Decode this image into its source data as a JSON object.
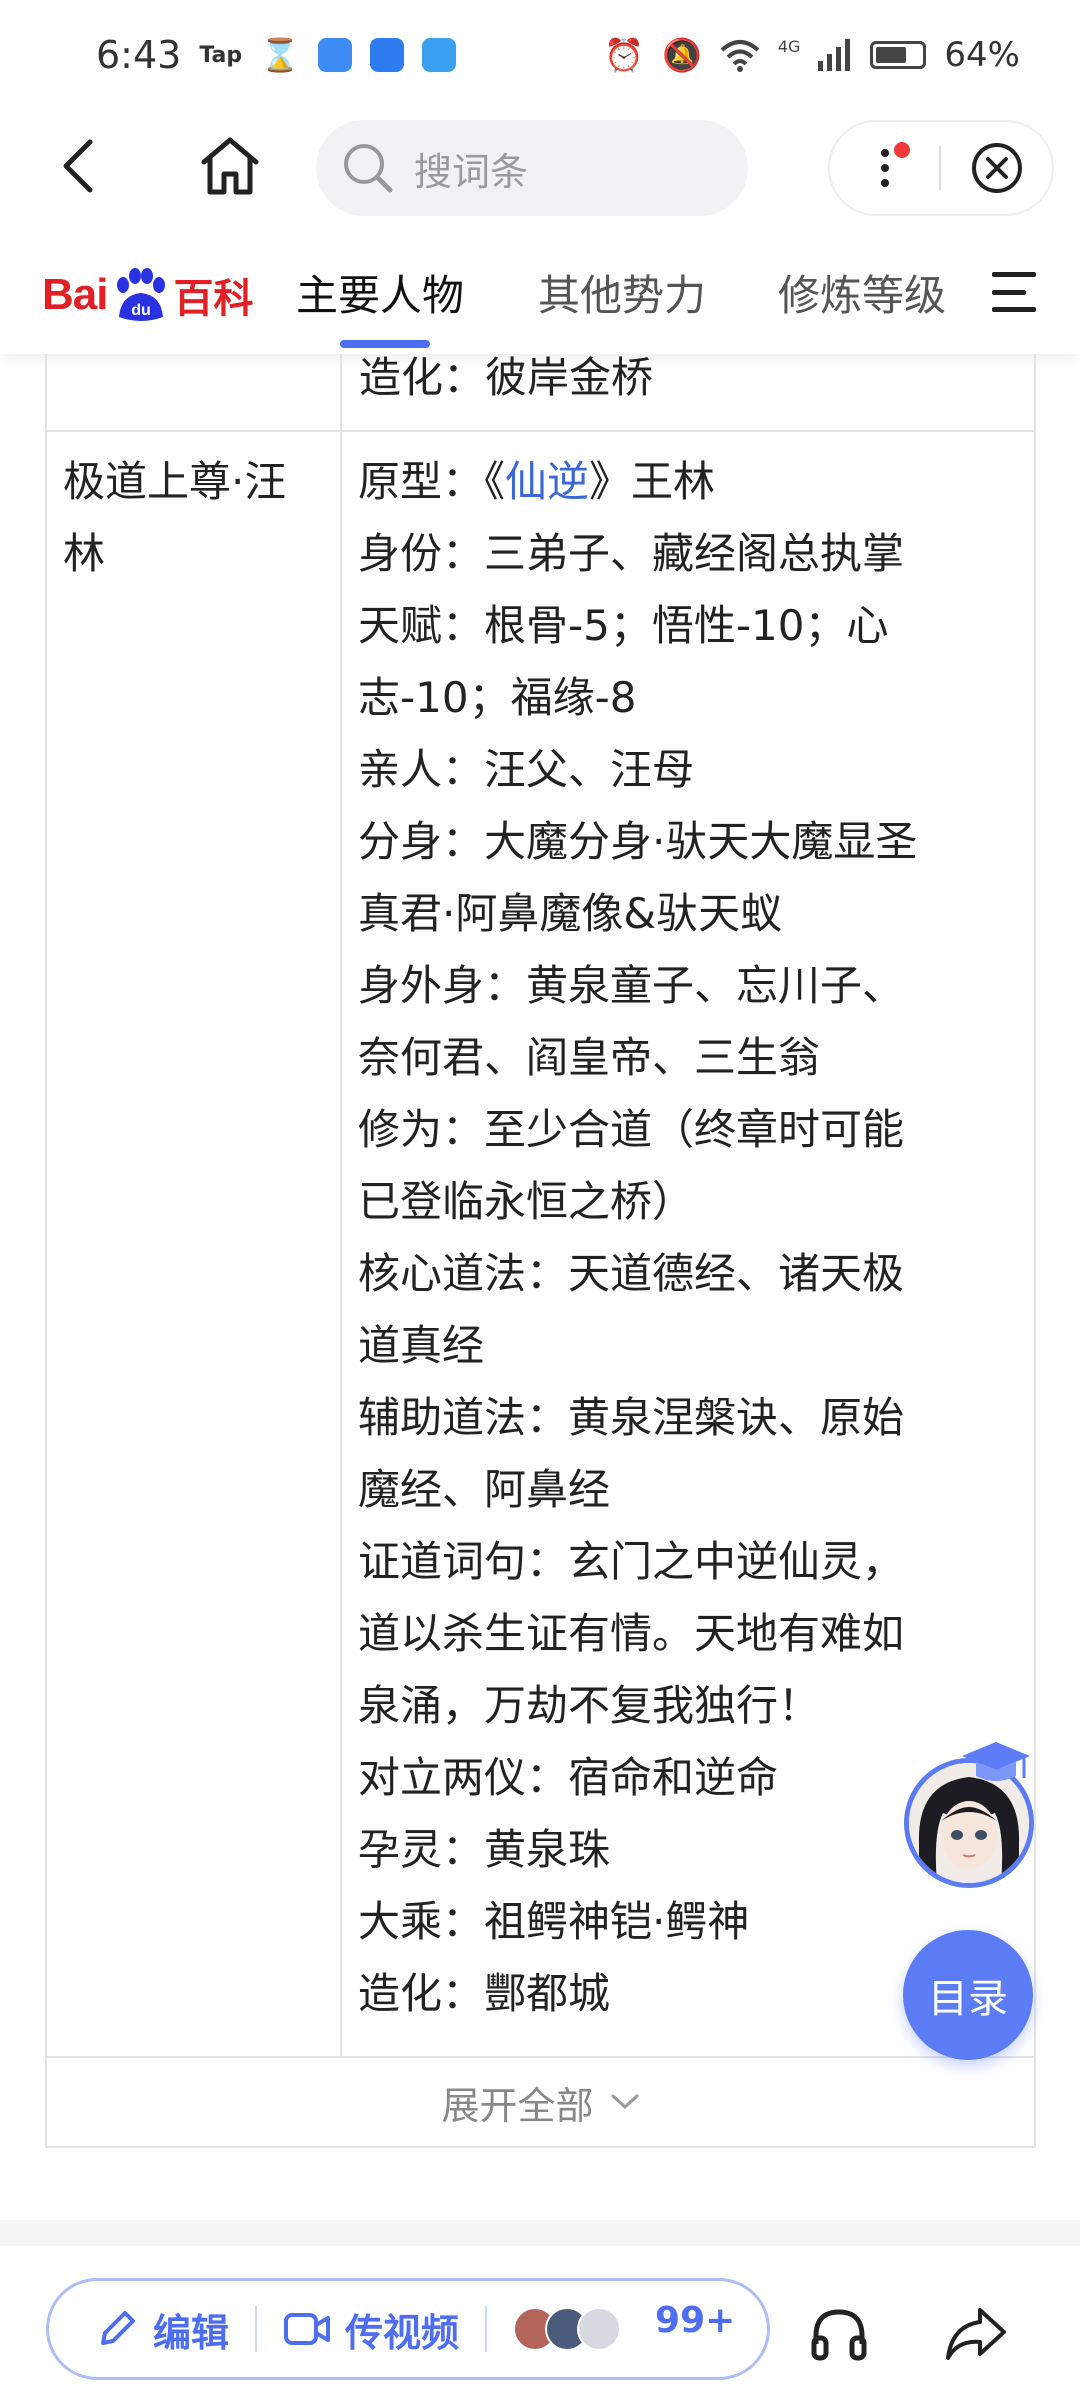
{
  "status_bar": {
    "time": "6:43",
    "tap_label": "Tap",
    "network_label": "4G",
    "battery_percent": "64%"
  },
  "nav": {
    "search_placeholder": "搜词条"
  },
  "baike": {
    "logo_bai": "Bai",
    "logo_du": "du",
    "logo_baike": "百科",
    "tabs": [
      "主要人物",
      "其他势力",
      "修炼等级"
    ],
    "active_tab_index": 0,
    "accent_color": "#4e6ef2"
  },
  "table": {
    "partial_row_text": "造化：彼岸金桥",
    "character": {
      "name": "极道上尊·汪林",
      "prototype_prefix": "原型：《",
      "prototype_link": "仙逆",
      "prototype_suffix": "》王林",
      "lines": [
        "身份：三弟子、藏经阁总执掌",
        "天赋：根骨-5；悟性-10；心",
        "志-10；福缘-8",
        "亲人：汪父、汪母",
        "分身：大魔分身·驮天大魔显圣",
        "真君·阿鼻魔像&驮天蚁",
        "身外身：黄泉童子、忘川子、",
        "奈何君、阎皇帝、三生翁",
        "修为：至少合道（终章时可能",
        "已登临永恒之桥）",
        "核心道法：天道德经、诸天极",
        "道真经",
        "辅助道法：黄泉涅槃诀、原始",
        "魔经、阿鼻经",
        "证道词句：玄门之中逆仙灵，",
        "道以杀生证有情。天地有难如",
        "泉涌，万劫不复我独行！",
        "对立两仪：宿命和逆命",
        "孕灵：黄泉珠",
        "大乘：祖鳄神铠·鳄神",
        "造化：酆都城"
      ]
    },
    "expand_label": "展开全部"
  },
  "floating": {
    "toc_label": "目录"
  },
  "bottom_bar": {
    "edit_label": "编辑",
    "video_label": "传视频",
    "contributors_count": "99+"
  }
}
